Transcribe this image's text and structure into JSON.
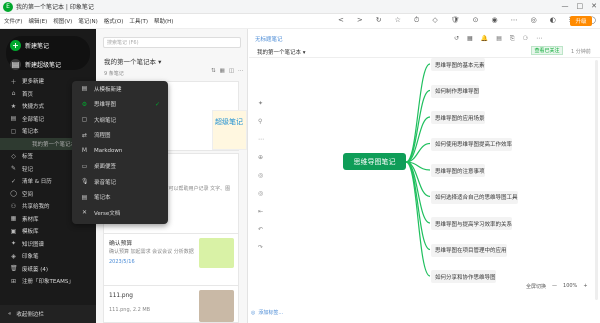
{
  "window": {
    "app_icon_letter": "E",
    "title": "我的第一个笔记本 | 印象笔记",
    "controls": [
      "—",
      "□",
      "✕"
    ]
  },
  "menubar": {
    "items": [
      "文件(F)",
      "编辑(E)",
      "视图(V)",
      "笔记(N)",
      "格式(O)",
      "工具(T)",
      "帮助(H)"
    ],
    "tool_icons": [
      "<",
      ">",
      "↻",
      "☆",
      "⏱",
      "◇",
      "🛡",
      "⊙",
      "◉",
      "⋯",
      "◎",
      "◐",
      "☰",
      "◯"
    ],
    "upgrade_label": "升级"
  },
  "sidebar": {
    "new_note": "新建笔记",
    "new_evernote": "新建超级笔记",
    "items": [
      {
        "icon": "＋",
        "label": "更多新建"
      },
      {
        "icon": "⌂",
        "label": "首页"
      },
      {
        "icon": "★",
        "label": "快捷方式"
      },
      {
        "icon": "▤",
        "label": "全部笔记"
      },
      {
        "icon": "▢",
        "label": "笔记本"
      },
      {
        "icon": "",
        "label": "我的第一个笔记本 (9)"
      },
      {
        "icon": "◇",
        "label": "标签"
      },
      {
        "icon": "✎",
        "label": "轻记"
      },
      {
        "icon": "✓",
        "label": "清单 & 日历"
      },
      {
        "icon": "◯",
        "label": "空间"
      },
      {
        "icon": "⚇",
        "label": "共享给我的"
      },
      {
        "icon": "▦",
        "label": "素材库"
      },
      {
        "icon": "▣",
        "label": "模板库"
      },
      {
        "icon": "✦",
        "label": "知识图谱"
      },
      {
        "icon": "◈",
        "label": "印象笔"
      },
      {
        "icon": "🗑",
        "label": "废纸篓 (4)"
      },
      {
        "icon": "⊞",
        "label": "注册「印象TEAMS」"
      }
    ],
    "collapse_label": "收起侧边栏"
  },
  "notelist": {
    "search_placeholder": "搜索笔记 (F6)",
    "notebook_title": "我的第一个笔记本 ▾",
    "count": "9 条笔记",
    "tools": [
      "⇅",
      "▦",
      "◫",
      "⋯"
    ],
    "cards": [
      {
        "title": "思维导图",
        "sub": "",
        "date": ""
      },
      {
        "title": "",
        "sub": "...笔记可以帮助用户记录...可以帮助用户记录 文字、图片、视频等。除此之...",
        "date": ""
      },
      {
        "title": "确认预算",
        "sub": "确认预算 加起需求 会议会议 分析数据",
        "date": "2023/5/16"
      },
      {
        "title": "111.png",
        "sub": "111.png, 2.2 MB",
        "date": ""
      }
    ],
    "right_card_title": "超级笔记"
  },
  "popup": {
    "items": [
      {
        "icon": "▤",
        "label": "从模板新建",
        "selected": false
      },
      {
        "icon": "⚙",
        "label": "思维导图",
        "selected": true
      },
      {
        "icon": "▢",
        "label": "大纲笔记",
        "selected": false
      },
      {
        "icon": "⇄",
        "label": "流程图",
        "selected": false
      },
      {
        "icon": "M",
        "label": "Markdown",
        "selected": false
      },
      {
        "icon": "▭",
        "label": "桌面便签",
        "selected": false
      },
      {
        "icon": "🎙",
        "label": "录音笔记",
        "selected": false
      },
      {
        "icon": "▤",
        "label": "笔记本",
        "selected": false
      },
      {
        "icon": "✕",
        "label": "Verse文档",
        "selected": false
      }
    ],
    "check": "✓"
  },
  "editor": {
    "crumb": "无标题笔记",
    "notebook_select": "我的第一个笔记本 ▾",
    "tools": [
      "↺",
      "▦",
      "🔔",
      "▤",
      "⎘",
      "⚆",
      "⋯"
    ],
    "share_label": "查看已关注",
    "updated_label": "1 分钟前",
    "left_tools": [
      "✦",
      "⚲",
      "⋯",
      "⊕",
      "◎",
      "◎",
      "⇤",
      "↶",
      "↷"
    ],
    "zoom_label": "全屏切换",
    "zoom_value": "100%",
    "zoom_minus": "—",
    "zoom_plus": "+",
    "status_text": "添加标签..."
  },
  "mindmap": {
    "root": "思维导图笔记",
    "branches": [
      "思维导图的基本元素",
      "如何制作思维导图",
      "思维导图的应用场景",
      "如何使用思维导图提高工作效率",
      "思维导图的注意事项",
      "如何选择适合自己的思维导图工具",
      "思维导图与提高学习效率的关系",
      "思维导图在项目管理中的应用",
      "如何分享和协作思维导图"
    ],
    "colors": {
      "root": "#0f9d58",
      "line": "#1fbf5e",
      "node": "#f3f3f3"
    }
  }
}
